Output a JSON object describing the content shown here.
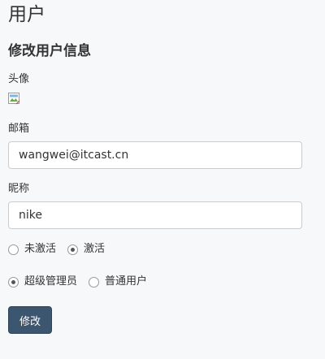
{
  "page": {
    "title": "用户"
  },
  "form": {
    "title": "修改用户信息",
    "avatar_label": "头像",
    "email_label": "邮箱",
    "email_value": "wangwei@itcast.cn",
    "nickname_label": "昵称",
    "nickname_value": "nike",
    "status_options": [
      {
        "label": "未激活",
        "checked": false
      },
      {
        "label": "激活",
        "checked": true
      }
    ],
    "role_options": [
      {
        "label": "超级管理员",
        "checked": true
      },
      {
        "label": "普通用户",
        "checked": false
      }
    ],
    "submit_label": "修改"
  },
  "colors": {
    "background": "#f7f8fa",
    "button": "#3d5670",
    "input_border": "#cccccc"
  },
  "icons": {
    "avatar": "broken-image-icon"
  }
}
